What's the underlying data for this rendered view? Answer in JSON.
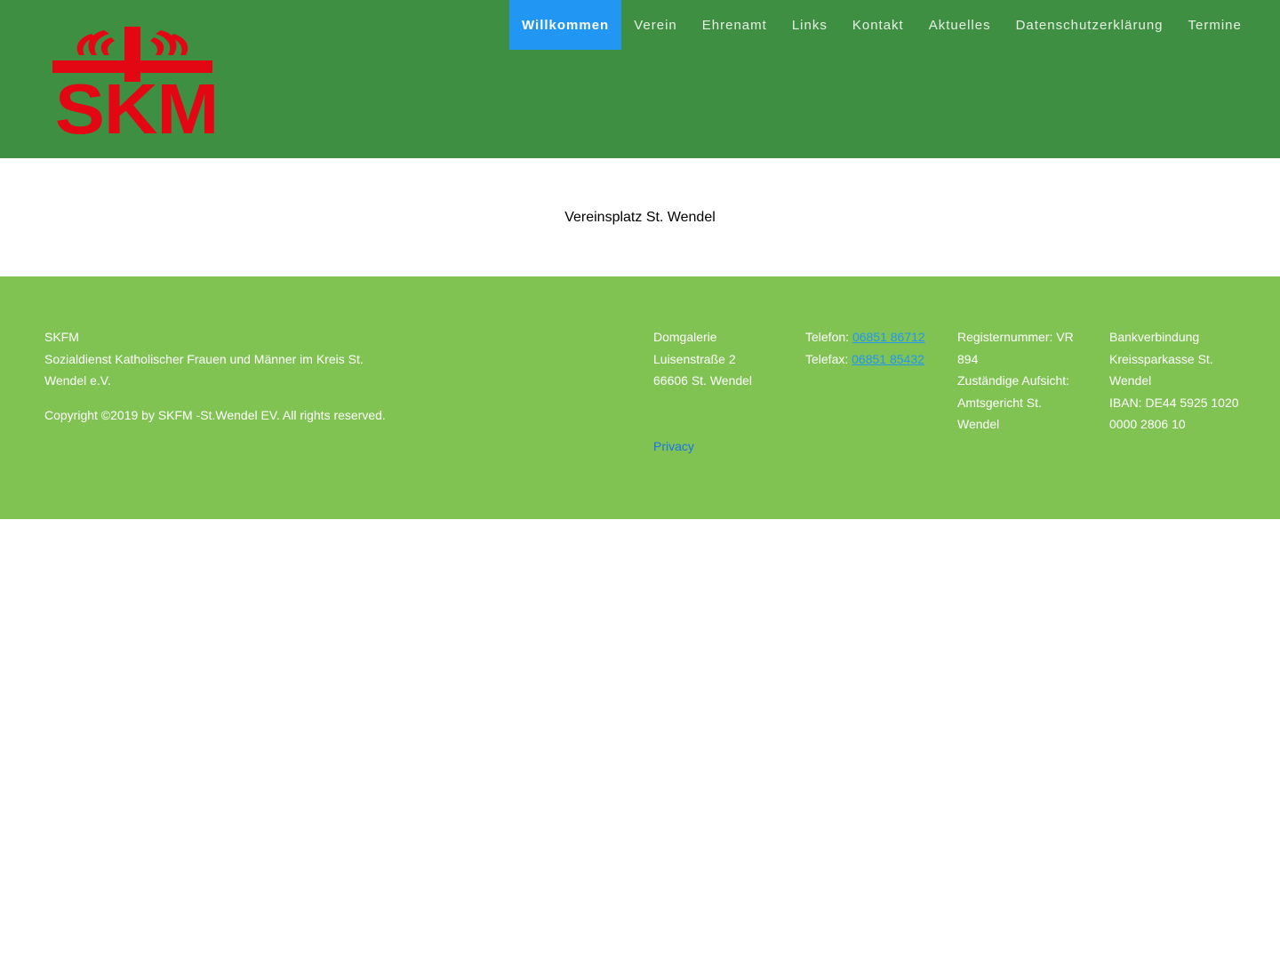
{
  "logo": {
    "text": "SKM",
    "color": "#e30613"
  },
  "nav": {
    "items": [
      {
        "label": "Willkommen",
        "active": true
      },
      {
        "label": "Verein"
      },
      {
        "label": "Ehrenamt"
      },
      {
        "label": "Links"
      },
      {
        "label": "Kontakt"
      },
      {
        "label": "Aktuelles"
      },
      {
        "label": "Datenschutzerklärung"
      },
      {
        "label": "Termine"
      }
    ],
    "active_color": "#2196f3"
  },
  "main": {
    "title": "Vereinsplatz St. Wendel"
  },
  "footer": {
    "org": {
      "line1": "SKFM",
      "line2": "Sozialdienst Katholischer Frauen und Männer im Kreis St. Wendel e.V."
    },
    "copyright": "Copyright ©2019 by SKFM -St.Wendel EV. All rights reserved.",
    "address": {
      "line1": "Domgalerie",
      "line2": "Luisenstraße 2",
      "line3": "66606 St. Wendel"
    },
    "privacy_label": "Privacy",
    "phone": {
      "tel_label": "Telefon: ",
      "tel_value": "06851 86712",
      "fax_label": "Telefax: ",
      "fax_value": "06851 85432"
    },
    "register": {
      "line1": "Registernummer: VR 894",
      "line2": "Zuständige Aufsicht: Amtsgericht St. Wendel"
    },
    "bank": {
      "line1": "Bankverbindung",
      "line2": "Kreissparkasse St. Wendel",
      "line3": "IBAN: DE44 5925 1020 0000 2806 10"
    }
  },
  "colors": {
    "header_bg": "#3f8f42",
    "footer_bg": "#80c353",
    "link": "#2196f3"
  }
}
